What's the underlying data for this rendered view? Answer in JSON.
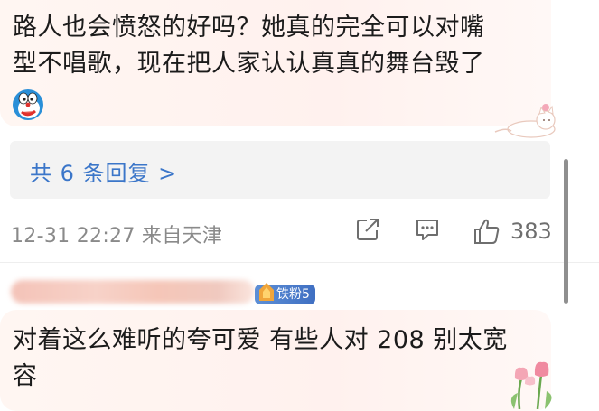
{
  "comment1": {
    "line1": "路人也会愤怒的好吗？她真的完全可以对嘴",
    "line2": "型不唱歌，现在把人家认认真真的舞台毁了",
    "emoji": "doraemon-emoji"
  },
  "replies": {
    "label": "共 6 条回复 >"
  },
  "meta": {
    "timestamp": "12-31 22:27 来自天津",
    "like_count": "383"
  },
  "comment2": {
    "badge": "铁粉5",
    "line1": "对着这么难听的夸可爱 有些人对 208 别太宽",
    "line2": "容"
  },
  "colors": {
    "bubble": "#fff3ef",
    "link": "#3b76c9",
    "meta": "#8a8a8a",
    "badge": "#4a7dcc"
  }
}
